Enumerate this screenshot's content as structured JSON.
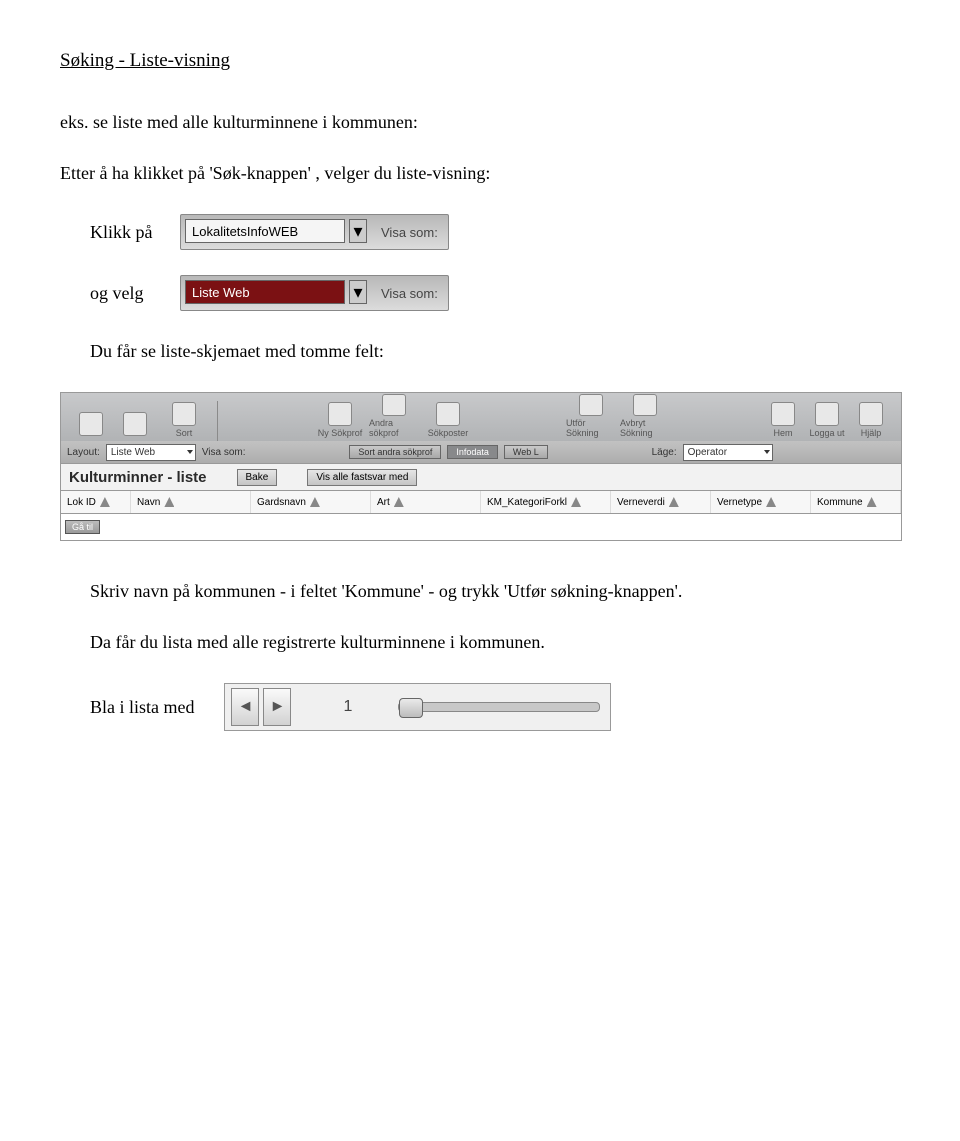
{
  "heading": "Søking - Liste-visning",
  "p1": "eks. se liste med alle kulturminnene i kommunen:",
  "p2": "Etter å ha klikket på 'Søk-knappen' , velger du liste-visning:",
  "label_klikk": "Klikk på",
  "dd1": {
    "value": "LokalitetsInfoWEB",
    "aftertext": "Visa som:"
  },
  "label_ogvelg": "og velg",
  "dd2": {
    "value": "Liste Web",
    "aftertext": "Visa som:"
  },
  "p3": "Du får se liste-skjemaet med tomme felt:",
  "toolbar": {
    "btns_left": [
      "",
      "",
      "Sort"
    ],
    "btns_mid": [
      "Ny Sökprof",
      "Andra sökprof",
      "Sökposter"
    ],
    "btns_right1": [
      "Utför Sökning",
      "Avbryt Sökning"
    ],
    "btns_right2": [
      "Hem",
      "Logga ut",
      "Hjälp"
    ]
  },
  "row2": {
    "layout_label": "Layout:",
    "layout_value": "Liste Web",
    "visa_label": "Visa som:",
    "tabs": [
      "Sort andra sökprof",
      "Infodata",
      "Web L"
    ],
    "lage_label": "Läge:",
    "lage_value": "Operator"
  },
  "titlebar": {
    "title": "Kulturminner - liste",
    "btn1": "Bake",
    "btn2": "Vis alle fastsvar med"
  },
  "columns": [
    "Lok ID",
    "Navn",
    "Gardsnavn",
    "Art",
    "KM_KategoriForkl",
    "Verneverdi",
    "Vernetype",
    "Kommune"
  ],
  "status": "Gå til",
  "p4": "Skriv navn på kommunen - i feltet 'Kommune' - og trykk 'Utfør søkning-knappen'.",
  "p5": "Da får du lista med alle registrerte kulturminnene i kommunen.",
  "p6": "Bla i lista med",
  "pager": {
    "prev": "◄",
    "next": "►",
    "num": "1"
  }
}
